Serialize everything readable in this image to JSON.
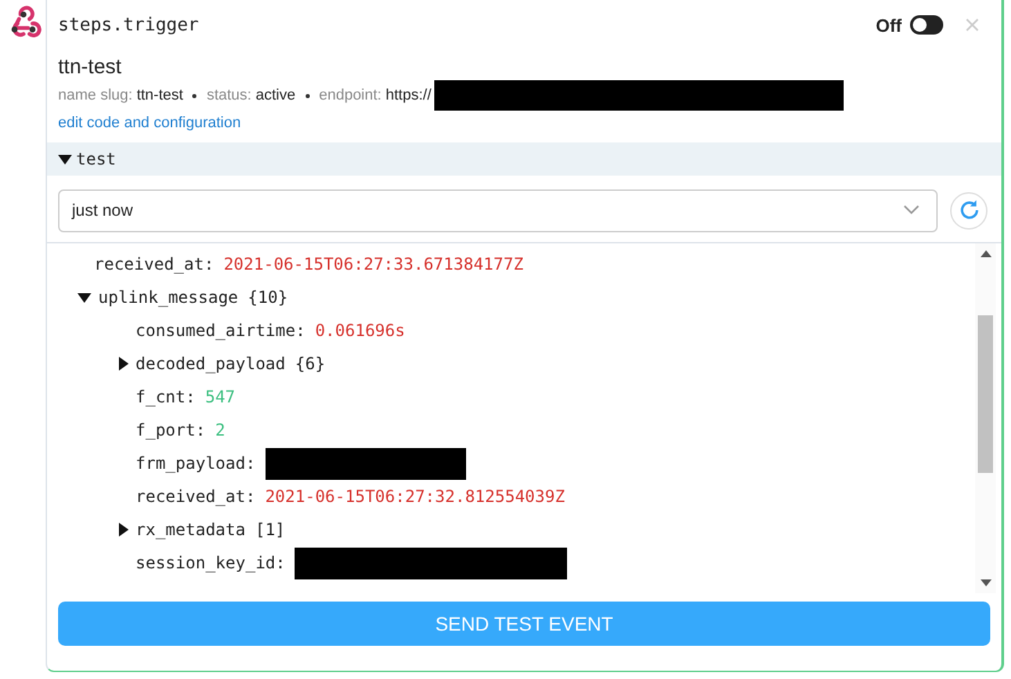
{
  "step": {
    "title": "steps.trigger",
    "toggle_label": "Off",
    "on": false,
    "name": "ttn-test",
    "meta": [
      {
        "label": "name slug:",
        "value": "ttn-test"
      },
      {
        "label": "status:",
        "value": "active"
      },
      {
        "label": "endpoint:",
        "value": "https://",
        "redacted": true
      }
    ],
    "link": "edit code and configuration"
  },
  "section": {
    "title": "test",
    "expanded": true
  },
  "event_select": {
    "value": "just now"
  },
  "tree": [
    {
      "kind": "value",
      "key": "received_at:",
      "value": "2021-06-15T06:27:33.671384177Z",
      "color": "#d6302b"
    },
    {
      "kind": "group",
      "key": "uplink_message",
      "count": "{10}",
      "expanded": true,
      "children": [
        {
          "kind": "value",
          "key": "consumed_airtime:",
          "value": "0.061696s",
          "color": "#d6302b"
        },
        {
          "kind": "group",
          "key": "decoded_payload",
          "count": "{6}",
          "expanded": false
        },
        {
          "kind": "value",
          "key": "f_cnt:",
          "value": "547",
          "color": "#3cbf80"
        },
        {
          "kind": "value",
          "key": "f_port:",
          "value": "2",
          "color": "#3cbf80"
        },
        {
          "kind": "redacted",
          "key": "frm_payload:"
        },
        {
          "kind": "value",
          "key": "received_at:",
          "value": "2021-06-15T06:27:32.812554039Z",
          "color": "#d6302b"
        },
        {
          "kind": "group",
          "key": "rx_metadata",
          "count": "[1]",
          "expanded": false
        },
        {
          "kind": "redacted",
          "key": "session_key_id:"
        }
      ]
    }
  ],
  "button": "SEND TEST EVENT"
}
